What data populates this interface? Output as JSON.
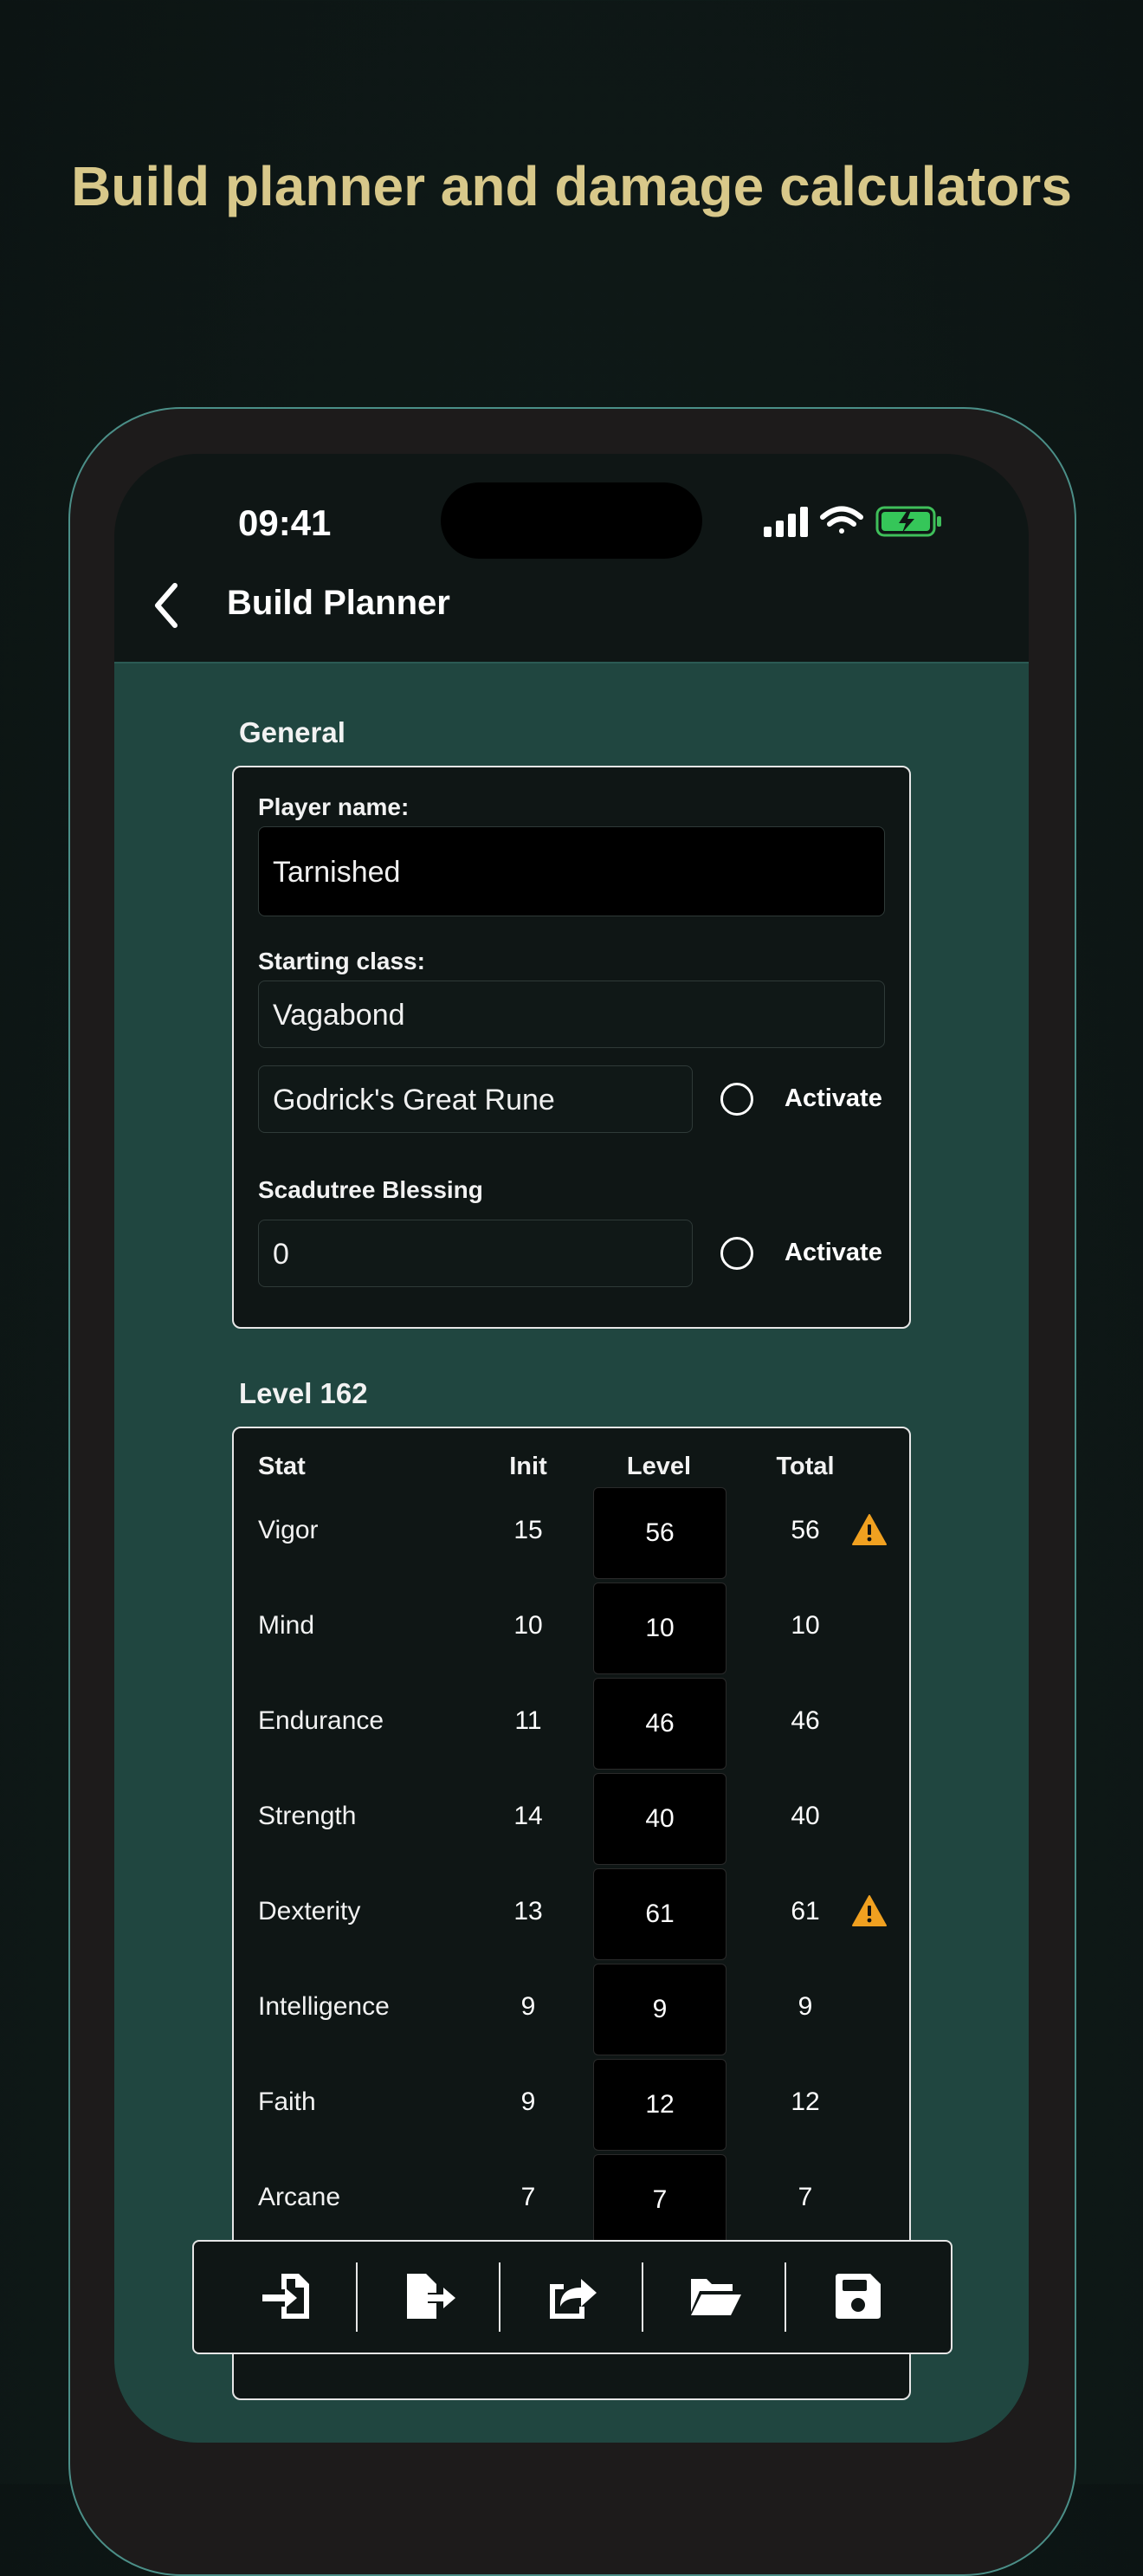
{
  "headline": "Build planner and damage calculators",
  "status_bar": {
    "time": "09:41"
  },
  "nav": {
    "title": "Build Planner"
  },
  "general": {
    "section_title": "General",
    "player_name_label": "Player name:",
    "player_name_value": "Tarnished",
    "starting_class_label": "Starting class:",
    "starting_class_value": "Vagabond",
    "great_rune_value": "Godrick's Great Rune",
    "great_rune_toggle_label": "Activate",
    "scadutree_label": "Scadutree Blessing",
    "scadutree_value": "0",
    "scadutree_toggle_label": "Activate"
  },
  "level": {
    "section_title": "Level 162",
    "columns": [
      "Stat",
      "Init",
      "Level",
      "Total"
    ],
    "rows": [
      {
        "stat": "Vigor",
        "init": "15",
        "level": "56",
        "total": "56",
        "warning": true
      },
      {
        "stat": "Mind",
        "init": "10",
        "level": "10",
        "total": "10",
        "warning": false
      },
      {
        "stat": "Endurance",
        "init": "11",
        "level": "46",
        "total": "46",
        "warning": false
      },
      {
        "stat": "Strength",
        "init": "14",
        "level": "40",
        "total": "40",
        "warning": false
      },
      {
        "stat": "Dexterity",
        "init": "13",
        "level": "61",
        "total": "61",
        "warning": true
      },
      {
        "stat": "Intelligence",
        "init": "9",
        "level": "9",
        "total": "9",
        "warning": false
      },
      {
        "stat": "Faith",
        "init": "9",
        "level": "12",
        "total": "12",
        "warning": false
      },
      {
        "stat": "Arcane",
        "init": "7",
        "level": "7",
        "total": "7",
        "warning": false
      }
    ]
  },
  "toolbar": {
    "icons": [
      "import-icon",
      "export-file-icon",
      "share-icon",
      "open-folder-icon",
      "save-icon"
    ]
  },
  "colors": {
    "accent_headline": "#d8c88a",
    "content_bg": "#204640",
    "warning": "#f0a020"
  }
}
